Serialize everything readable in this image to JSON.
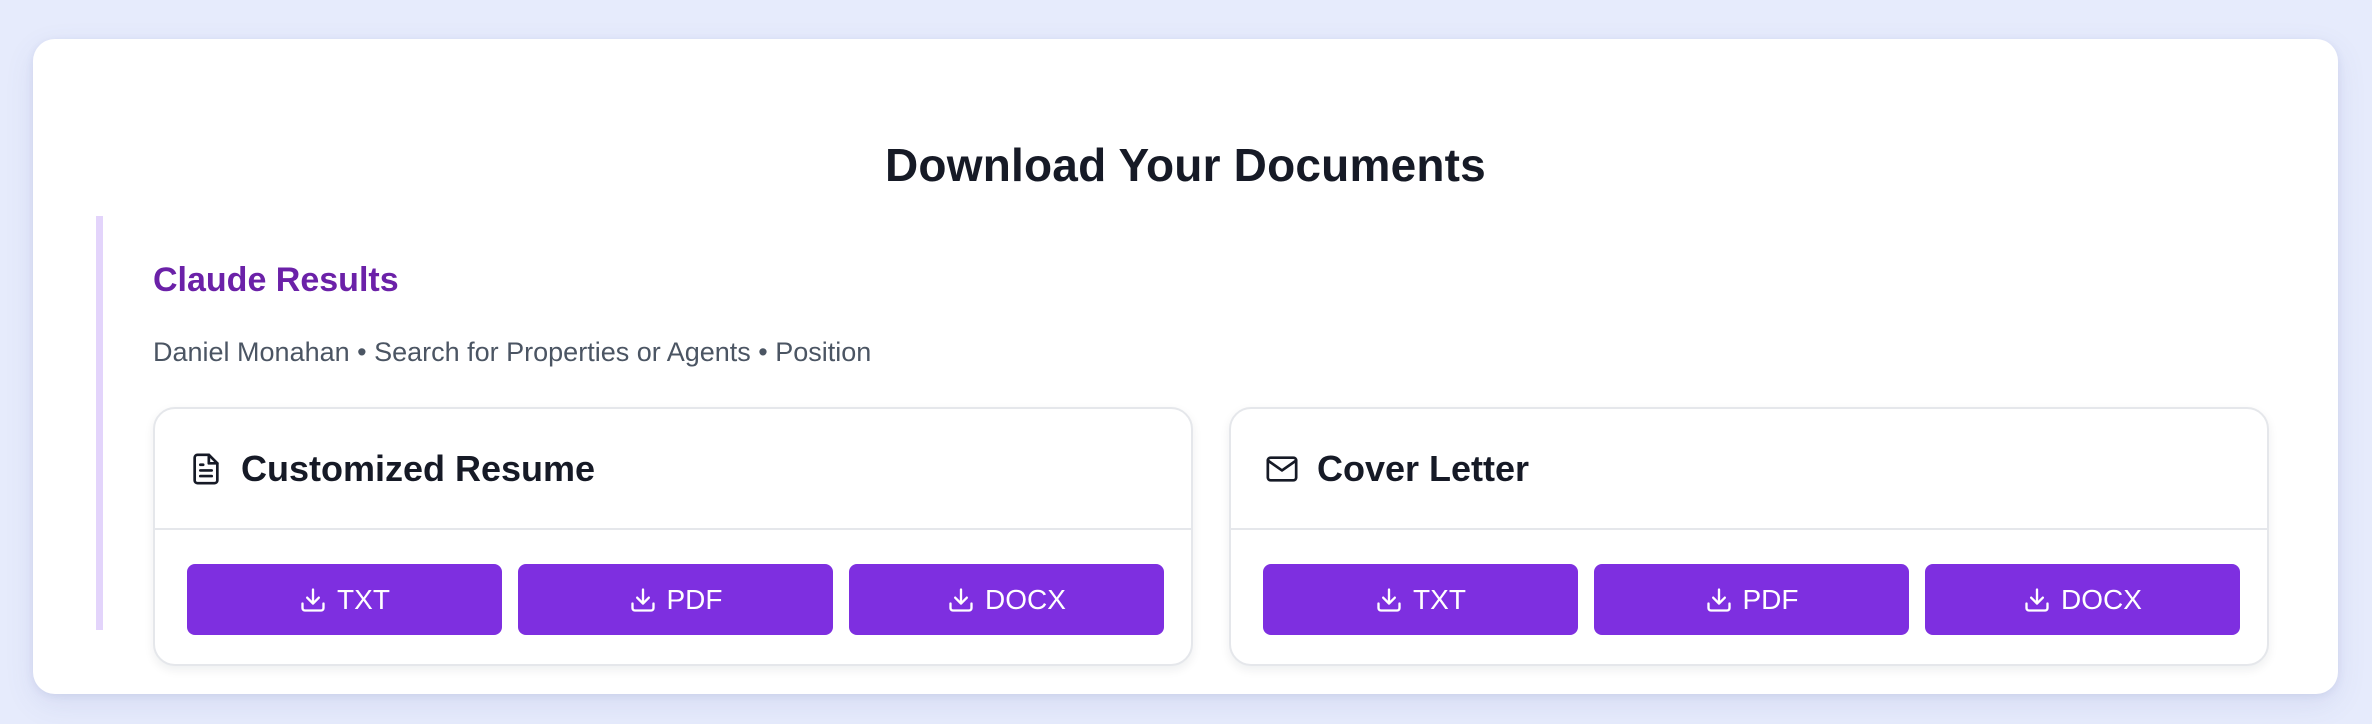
{
  "page": {
    "title": "Download Your Documents"
  },
  "results": {
    "title": "Claude Results",
    "meta": "Daniel Monahan • Search for Properties or Agents • Position"
  },
  "cards": {
    "resume": {
      "title": "Customized Resume",
      "icon": "document-icon",
      "buttons": {
        "txt": "TXT",
        "pdf": "PDF",
        "docx": "DOCX"
      }
    },
    "cover": {
      "title": "Cover Letter",
      "icon": "mail-icon",
      "buttons": {
        "txt": "TXT",
        "pdf": "PDF",
        "docx": "DOCX"
      }
    }
  },
  "colors": {
    "background": "#e6ebfc",
    "accent": "#7e2fe0",
    "section_title": "#6b21a8",
    "section_border": "#e3d4fb"
  }
}
